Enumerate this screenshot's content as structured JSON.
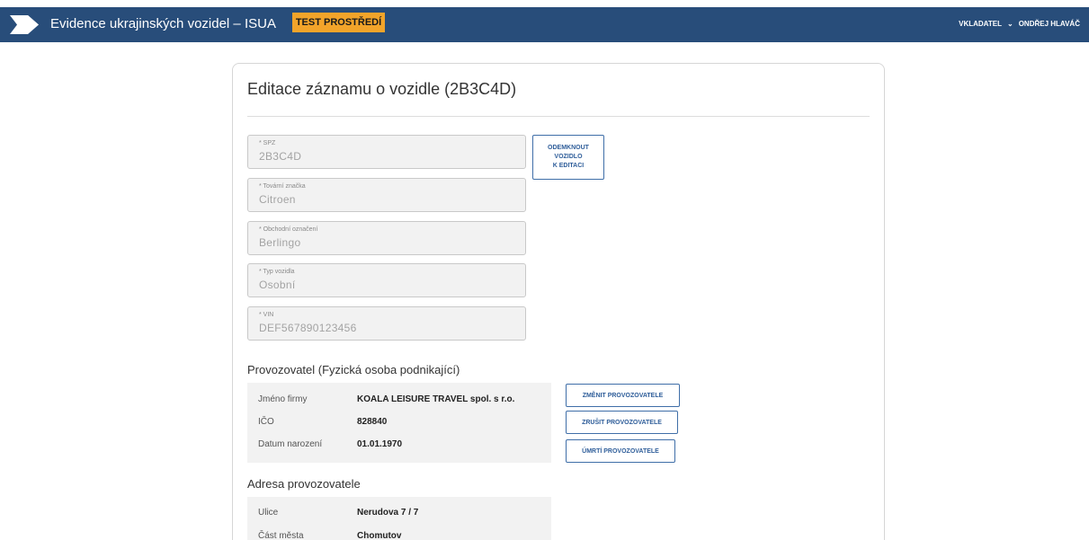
{
  "header": {
    "app_title": "Evidence ukrajinských vozidel – ISUA",
    "env_badge": "TEST PROSTŘEDÍ",
    "role": "VKLADATEL",
    "user_name": "ONDŘEJ HLAVÁČ",
    "colors": {
      "bar": "#284d7a",
      "badge": "#f2a42a"
    }
  },
  "page": {
    "title": "Editace záznamu o vozidle (2B3C4D)"
  },
  "fields": [
    {
      "label": "* SPZ",
      "value": "2B3C4D"
    },
    {
      "label": "* Tovární značka",
      "value": "Citroen"
    },
    {
      "label": "* Obchodní označení",
      "value": "Berlingo"
    },
    {
      "label": "* Typ vozidla",
      "value": "Osobní"
    },
    {
      "label": "* VIN",
      "value": "DEF567890123456"
    }
  ],
  "unlock_button": {
    "line1": "ODEMKNOUT",
    "line2": "VOZIDLO",
    "line3": "K EDITACI"
  },
  "operator": {
    "heading": "Provozovatel (Fyzická osoba podnikající)",
    "rows": [
      {
        "label": "Jméno firmy",
        "value": "KOALA LEISURE TRAVEL spol. s r.o."
      },
      {
        "label": "IČO",
        "value": "828840"
      },
      {
        "label": "Datum narození",
        "value": "01.01.1970"
      }
    ],
    "buttons": {
      "change": "ZMĚNIT PROVOZOVATELE",
      "cancel": "ZRUŠIT PROVOZOVATELE",
      "death": "ÚMRTÍ PROVOZOVATELE"
    }
  },
  "address": {
    "heading": "Adresa provozovatele",
    "rows": [
      {
        "label": "Ulice",
        "value": "Nerudova 7 / 7"
      },
      {
        "label": "Část města",
        "value": "Chomutov"
      }
    ]
  }
}
